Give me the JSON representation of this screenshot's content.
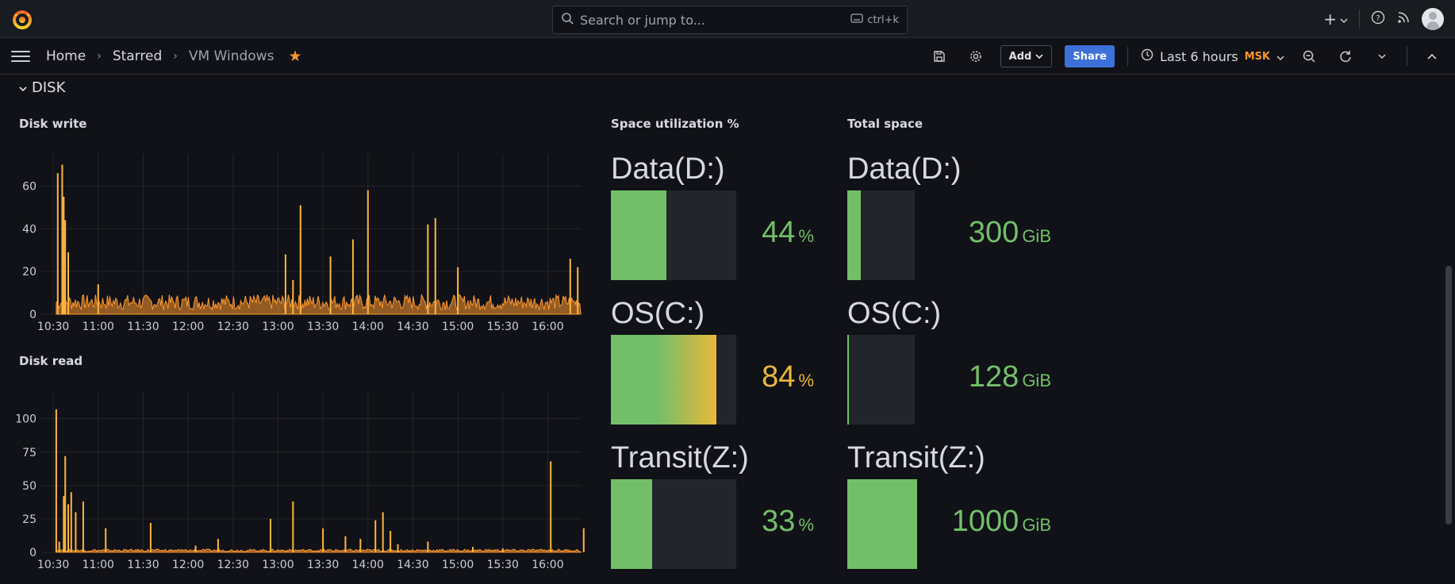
{
  "search": {
    "placeholder": "Search or jump to...",
    "shortcut": "ctrl+k"
  },
  "breadcrumbs": [
    "Home",
    "Starred",
    "VM Windows"
  ],
  "toolbar": {
    "add_label": "Add",
    "share_label": "Share",
    "time_range": "Last 6 hours",
    "timezone": "MSK"
  },
  "row": {
    "title": "DISK"
  },
  "panels": {
    "disk_write": {
      "title": "Disk write"
    },
    "disk_read": {
      "title": "Disk read"
    },
    "space_util": {
      "title": "Space utilization %"
    },
    "total_space": {
      "title": "Total space"
    }
  },
  "gauges": {
    "util": [
      {
        "label": "Data(D:)",
        "value": "44",
        "unit": "%",
        "fraction": 0.44,
        "color": "#73bf69"
      },
      {
        "label": "OS(C:)",
        "value": "84",
        "unit": "%",
        "fraction": 0.84,
        "color": "#eab839"
      },
      {
        "label": "Transit(Z:)",
        "value": "33",
        "unit": "%",
        "fraction": 0.33,
        "color": "#73bf69"
      }
    ],
    "space": [
      {
        "label": "Data(D:)",
        "value": "300",
        "unit": "GiB",
        "fraction": 0.2,
        "color": "#73bf69"
      },
      {
        "label": "OS(C:)",
        "value": "128",
        "unit": "GiB",
        "fraction": 0.02,
        "color": "#73bf69"
      },
      {
        "label": "Transit(Z:)",
        "value": "1000",
        "unit": "GiB",
        "fraction": 1.0,
        "color": "#73bf69"
      }
    ]
  },
  "chart_data": [
    {
      "type": "area",
      "title": "Disk write",
      "x_ticks": [
        "10:30",
        "11:00",
        "11:30",
        "12:00",
        "12:30",
        "13:00",
        "13:30",
        "14:00",
        "14:30",
        "15:00",
        "15:30",
        "16:00"
      ],
      "y_ticks": [
        0,
        20,
        40,
        60
      ],
      "ylim": [
        0,
        75
      ],
      "color": "#ff9830",
      "spikes": [
        {
          "t": "10:33",
          "v": 66
        },
        {
          "t": "10:36",
          "v": 70
        },
        {
          "t": "10:37",
          "v": 55
        },
        {
          "t": "10:38",
          "v": 44
        },
        {
          "t": "10:40",
          "v": 29
        },
        {
          "t": "11:00",
          "v": 14
        },
        {
          "t": "13:05",
          "v": 28
        },
        {
          "t": "13:10",
          "v": 16
        },
        {
          "t": "13:15",
          "v": 51
        },
        {
          "t": "13:35",
          "v": 27
        },
        {
          "t": "13:50",
          "v": 35
        },
        {
          "t": "14:00",
          "v": 58
        },
        {
          "t": "14:40",
          "v": 42
        },
        {
          "t": "14:45",
          "v": 45
        },
        {
          "t": "15:00",
          "v": 22
        },
        {
          "t": "16:15",
          "v": 26
        },
        {
          "t": "16:20",
          "v": 22
        }
      ],
      "baseline": 4
    },
    {
      "type": "area",
      "title": "Disk read",
      "x_ticks": [
        "10:30",
        "11:00",
        "11:30",
        "12:00",
        "12:30",
        "13:00",
        "13:30",
        "14:00",
        "14:30",
        "15:00",
        "15:30",
        "16:00"
      ],
      "y_ticks": [
        0,
        25,
        50,
        75,
        100
      ],
      "ylim": [
        0,
        120
      ],
      "color": "#ff9830",
      "spikes": [
        {
          "t": "10:32",
          "v": 107
        },
        {
          "t": "10:34",
          "v": 8
        },
        {
          "t": "10:37",
          "v": 42
        },
        {
          "t": "10:38",
          "v": 72
        },
        {
          "t": "10:40",
          "v": 36
        },
        {
          "t": "10:42",
          "v": 45
        },
        {
          "t": "10:45",
          "v": 30
        },
        {
          "t": "10:50",
          "v": 38
        },
        {
          "t": "11:05",
          "v": 18
        },
        {
          "t": "11:35",
          "v": 22
        },
        {
          "t": "12:05",
          "v": 5
        },
        {
          "t": "12:20",
          "v": 10
        },
        {
          "t": "12:55",
          "v": 25
        },
        {
          "t": "13:10",
          "v": 38
        },
        {
          "t": "13:30",
          "v": 18
        },
        {
          "t": "13:45",
          "v": 12
        },
        {
          "t": "13:55",
          "v": 10
        },
        {
          "t": "14:05",
          "v": 24
        },
        {
          "t": "14:10",
          "v": 30
        },
        {
          "t": "14:15",
          "v": 16
        },
        {
          "t": "14:20",
          "v": 6
        },
        {
          "t": "14:40",
          "v": 8
        },
        {
          "t": "15:10",
          "v": 4
        },
        {
          "t": "15:30",
          "v": 3
        },
        {
          "t": "16:02",
          "v": 68
        },
        {
          "t": "16:24",
          "v": 18
        }
      ],
      "baseline": 1
    }
  ]
}
